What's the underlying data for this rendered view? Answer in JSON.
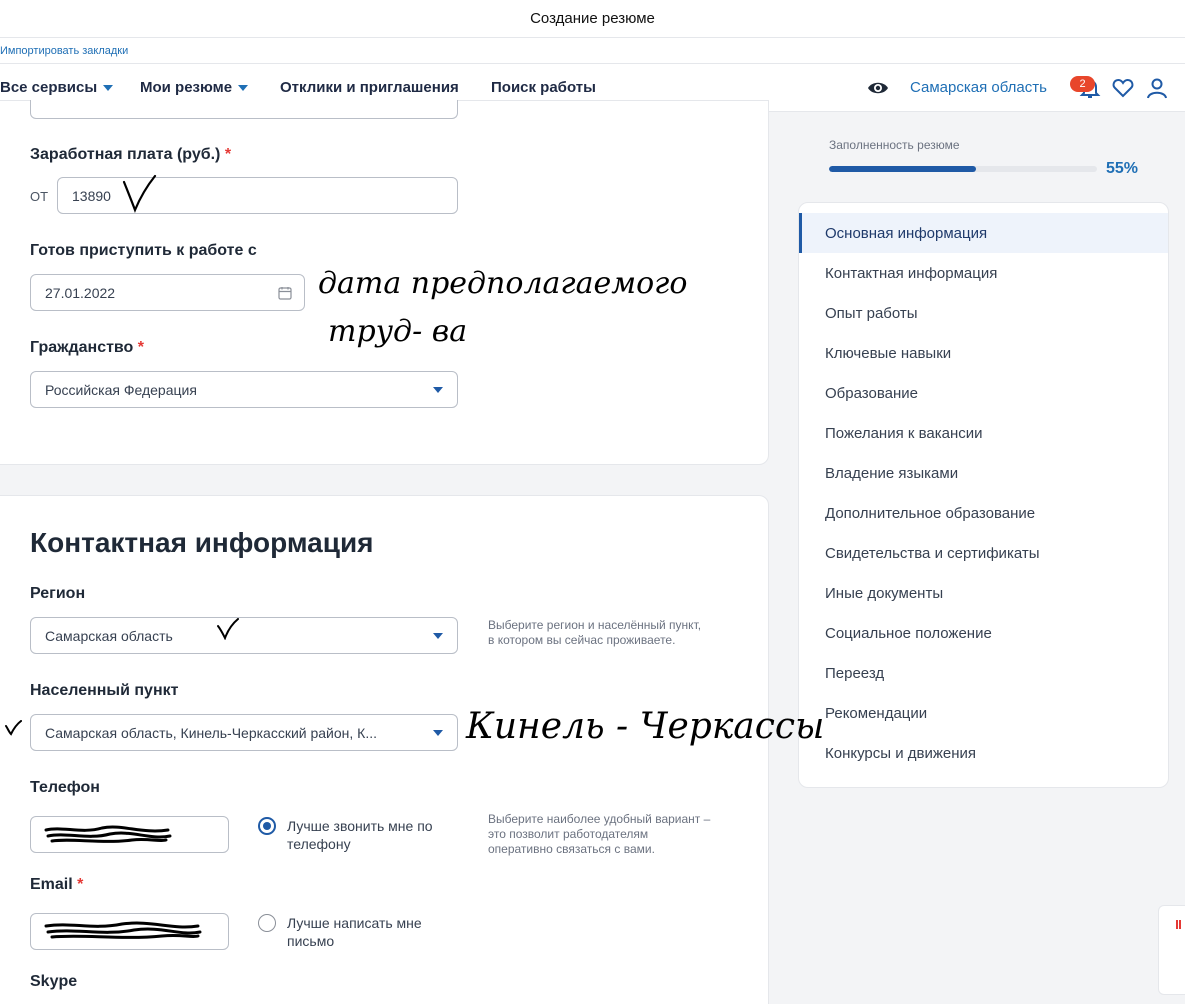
{
  "window": {
    "title": "Создание резюме"
  },
  "bookmarks": {
    "import_label": "Импортировать закладки"
  },
  "nav": {
    "all_services": "Все сервисы",
    "my_resumes": "Мои резюме",
    "responses": "Отклики и приглашения",
    "job_search": "Поиск работы",
    "region": "Самарская область",
    "notifications_count": "2",
    "icons": [
      "eye-icon",
      "bell-icon",
      "heart-icon",
      "user-icon"
    ]
  },
  "progress": {
    "label": "Заполненность резюме",
    "value": "55%",
    "fraction": 0.55
  },
  "form": {
    "salary_label": "Заработная плата (руб.)",
    "salary_from": "от",
    "salary_value": "13890",
    "start_label": "Готов приступить к работе с",
    "start_value": "27.01.2022",
    "citizenship_label": "Гражданство",
    "citizenship_value": "Российская Федерация",
    "required_mark": "*"
  },
  "contact": {
    "title": "Контактная информация",
    "region_label": "Регион",
    "region_value": "Самарская область",
    "region_hint_1": "Выберите регион и населённый пункт,",
    "region_hint_2": "в котором вы сейчас проживаете.",
    "locality_label": "Населенный пункт",
    "locality_value": "Самарская область, Кинель-Черкасский район, К...",
    "phone_label": "Телефон",
    "phone_radio_1": "Лучше звонить мне по",
    "phone_radio_2": "телефону",
    "phone_hint_1": "Выберите наиболее удобный вариант –",
    "phone_hint_2": "это позволит работодателям",
    "phone_hint_3": "оперативно связаться с вами.",
    "email_label": "Email",
    "email_radio_1": "Лучше написать мне",
    "email_radio_2": "письмо",
    "skype_label": "Skype"
  },
  "side_menu": {
    "items": [
      "Основная информация",
      "Контактная информация",
      "Опыт работы",
      "Ключевые навыки",
      "Образование",
      "Пожелания к вакансии",
      "Владение языками",
      "Дополнительное образование",
      "Свидетельства и сертификаты",
      "Иные документы",
      "Социальное положение",
      "Переезд",
      "Рекомендации",
      "Конкурсы и движения"
    ]
  },
  "annotations": {
    "date_note_1": "дата предполагаемого",
    "date_note_2": "труд- ва",
    "locality_note": "Кинель - Черкассы"
  },
  "colors": {
    "accent": "#1f5aa6",
    "link": "#1f6fb5",
    "required": "#e53935",
    "badge": "#e8462b"
  }
}
